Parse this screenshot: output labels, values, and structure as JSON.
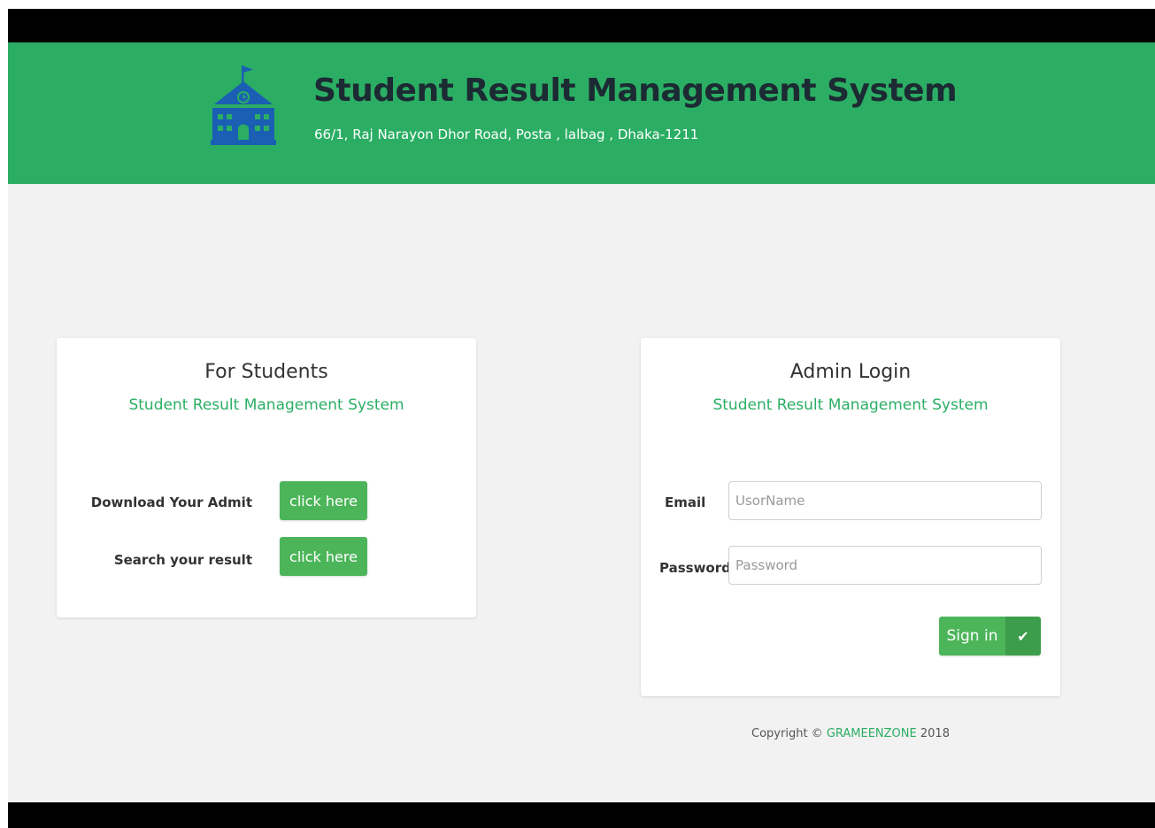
{
  "header": {
    "title": "Student Result Management System",
    "address": "66/1, Raj Narayon Dhor Road, Posta , lalbag , Dhaka-1211",
    "logo_icon": "school-building-icon"
  },
  "students_card": {
    "title": "For Students",
    "subtitle": "Student Result Management System",
    "rows": [
      {
        "label": "Download Your Admit",
        "button": "click here"
      },
      {
        "label": "Search your result",
        "button": "click here"
      }
    ]
  },
  "admin_card": {
    "title": "Admin Login",
    "subtitle": "Student Result Management System",
    "email_label": "Email",
    "email_placeholder": "UsorName",
    "password_label": "Password",
    "password_placeholder": "Password",
    "signin_label": "Sign in",
    "signin_icon": "check-icon"
  },
  "footer": {
    "copyright_prefix": "Copyright ©",
    "brand": "GRAMEENZONE",
    "year": "2018"
  },
  "colors": {
    "header_green": "#2bae64",
    "button_green": "#4cb55a",
    "icon_blue": "#1a5fb4",
    "title_dark": "#1c2a33"
  }
}
